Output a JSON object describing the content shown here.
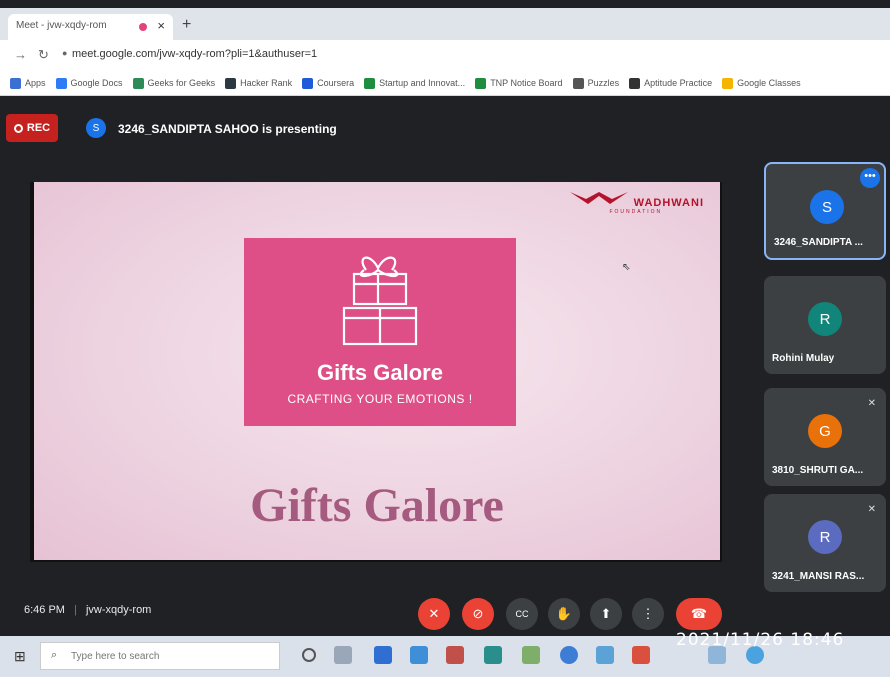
{
  "browser": {
    "tab_title": "Meet - jvw-xqdy-rom",
    "tab_close": "×",
    "new_tab": "+",
    "url": "meet.google.com/jvw-xqdy-rom?pli=1&authuser=1"
  },
  "bookmarks": [
    {
      "label": "Apps",
      "icon": "apps-grid-icon",
      "color": "#3b6fd4"
    },
    {
      "label": "Google Docs",
      "icon": "docs-icon",
      "color": "#2f7bf5"
    },
    {
      "label": "Geeks for Geeks",
      "icon": "gfg-icon",
      "color": "#2e8b57"
    },
    {
      "label": "Hacker Rank",
      "icon": "hackerrank-icon",
      "color": "#2b3a42"
    },
    {
      "label": "Coursera",
      "icon": "coursera-icon",
      "color": "#1f5bd8"
    },
    {
      "label": "Startup and Innovat...",
      "icon": "bookmark-icon",
      "color": "#1e8e3e"
    },
    {
      "label": "TNP Notice Board",
      "icon": "bookmark-icon",
      "color": "#1e8e3e"
    },
    {
      "label": "Puzzles",
      "icon": "puzzles-icon",
      "color": "#555555"
    },
    {
      "label": "Aptitude Practice",
      "icon": "aptitude-icon",
      "color": "#333333"
    },
    {
      "label": "Google Classes",
      "icon": "classroom-icon",
      "color": "#f4b400"
    }
  ],
  "meet": {
    "rec_label": "REC",
    "presenter_initial": "S",
    "presenter_text": "3246_SANDIPTA SAHOO is presenting",
    "meeting_time": "6:46 PM",
    "meeting_code": "jvw-xqdy-rom"
  },
  "slide": {
    "logo_text": "WADHWANI",
    "logo_sub": "FOUNDATION",
    "brand_title": "Gifts Galore",
    "brand_tagline": "CRAFTING YOUR EMOTIONS !",
    "big_title": "Gifts Galore"
  },
  "participants": [
    {
      "initial": "S",
      "name": "3246_SANDIPTA ...",
      "color": "#1a73e8",
      "muted": false,
      "active": true
    },
    {
      "initial": "R",
      "name": "Rohini Mulay",
      "color": "#12857a",
      "muted": false,
      "active": false
    },
    {
      "initial": "G",
      "name": "3810_SHRUTI GA...",
      "color": "#e8710a",
      "muted": true,
      "active": false
    },
    {
      "initial": "R",
      "name": "3241_MANSI RAS...",
      "color": "#5b6bc0",
      "muted": true,
      "active": false
    }
  ],
  "controls": [
    {
      "name": "mic-off-button",
      "icon": "mic-off-icon",
      "style": "red"
    },
    {
      "name": "camera-off-button",
      "icon": "camera-off-icon",
      "style": "red"
    },
    {
      "name": "captions-button",
      "icon": "captions-icon",
      "style": "gray"
    },
    {
      "name": "raise-hand-button",
      "icon": "hand-icon",
      "style": "gray"
    },
    {
      "name": "present-button",
      "icon": "present-icon",
      "style": "gray"
    },
    {
      "name": "more-options-button",
      "icon": "more-vert-icon",
      "style": "gray"
    },
    {
      "name": "end-call-button",
      "icon": "end-call-icon",
      "style": "end"
    }
  ],
  "taskbar": {
    "search_placeholder": "Type here to search"
  },
  "photo_timestamp": "2021/11/26  18:46"
}
